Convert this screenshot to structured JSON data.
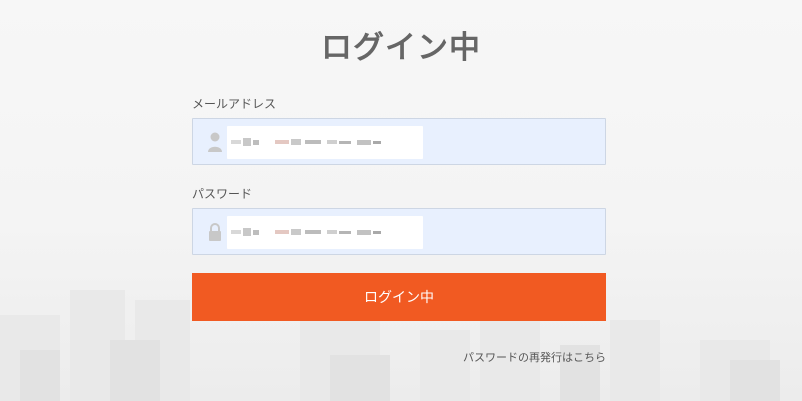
{
  "page": {
    "title": "ログイン中",
    "accent_color": "#f15a22"
  },
  "email": {
    "label": "メールアドレス",
    "icon": "user-icon"
  },
  "password": {
    "label": "パスワード",
    "icon": "lock-icon"
  },
  "actions": {
    "login_label": "ログイン中",
    "reset_link": "パスワードの再発行はこちら"
  }
}
